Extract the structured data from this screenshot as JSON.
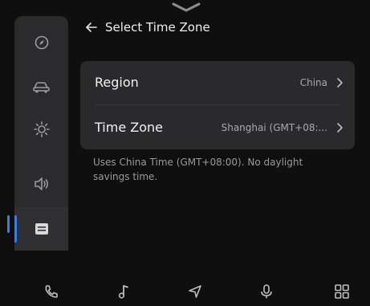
{
  "header": {
    "title": "Select Time Zone",
    "back_icon": "arrow-left-icon"
  },
  "sidebar": {
    "items": [
      {
        "icon": "compass-icon",
        "active": false
      },
      {
        "icon": "car-icon",
        "active": false
      },
      {
        "icon": "brightness-icon",
        "active": false
      },
      {
        "icon": "speaker-icon",
        "active": false
      },
      {
        "icon": "settings-list-icon",
        "active": true
      }
    ],
    "accent_color": "#3b7fe0"
  },
  "settings": {
    "region": {
      "label": "Region",
      "value": "China"
    },
    "timezone": {
      "label": "Time Zone",
      "value": "Shanghai (GMT+08:..."
    }
  },
  "note": "Uses China Time (GMT+08:00). No daylight savings time.",
  "dock": {
    "items": [
      "phone-icon",
      "music-note-icon",
      "navigation-arrow-icon",
      "microphone-icon",
      "apps-grid-icon"
    ]
  }
}
